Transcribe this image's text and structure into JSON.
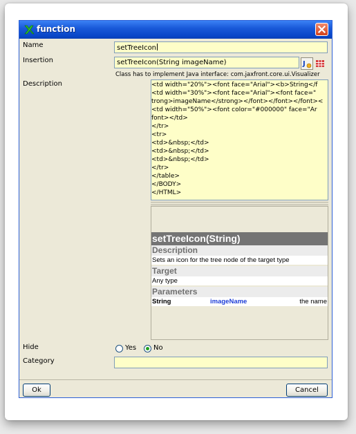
{
  "window": {
    "title": "function"
  },
  "form": {
    "name_label": "Name",
    "name_value": "setTreeIcon",
    "insertion_label": "Insertion",
    "insertion_value": "setTreeIcon(String imageName)",
    "insertion_hint": "Class has to implement Java interface:  com.jaxfront.core.ui.Visualizer",
    "description_label": "Description",
    "description_code": [
      "    <td width=\"20%\"><font face=\"Arial\"><b>String</f",
      "    <td width=\"30%\"><font face=\"Arial\"><font face=\"",
      "trong>imageName</strong></font></font></font><",
      "    <td width=\"50%\"><font color=\"#000000\" face=\"Ar",
      "font></td>",
      "  </tr>",
      "  <tr>",
      "    <td>&nbsp;</td>",
      "    <td>&nbsp;</td>",
      "    <td>&nbsp;</td>",
      "  </tr>",
      "</table>",
      "</BODY>",
      "</HTML>"
    ],
    "preview": {
      "heading": "setTreeIcon(String)",
      "description_title": "Description",
      "description_text": "Sets an icon for the tree node of the target type",
      "target_title": "Target",
      "target_text": "Any type",
      "parameters_title": "Parameters",
      "param_type": "String",
      "param_name": "imageName",
      "param_desc": "the name"
    },
    "hide_label": "Hide",
    "hide_options": {
      "yes": "Yes",
      "no": "No",
      "selected": "No"
    },
    "category_label": "Category",
    "category_value": ""
  },
  "buttons": {
    "ok": "Ok",
    "cancel": "Cancel"
  },
  "colors": {
    "field_bg": "#fefec8",
    "title_bar": "#0846c8",
    "param_name": "#1f3fd8"
  }
}
